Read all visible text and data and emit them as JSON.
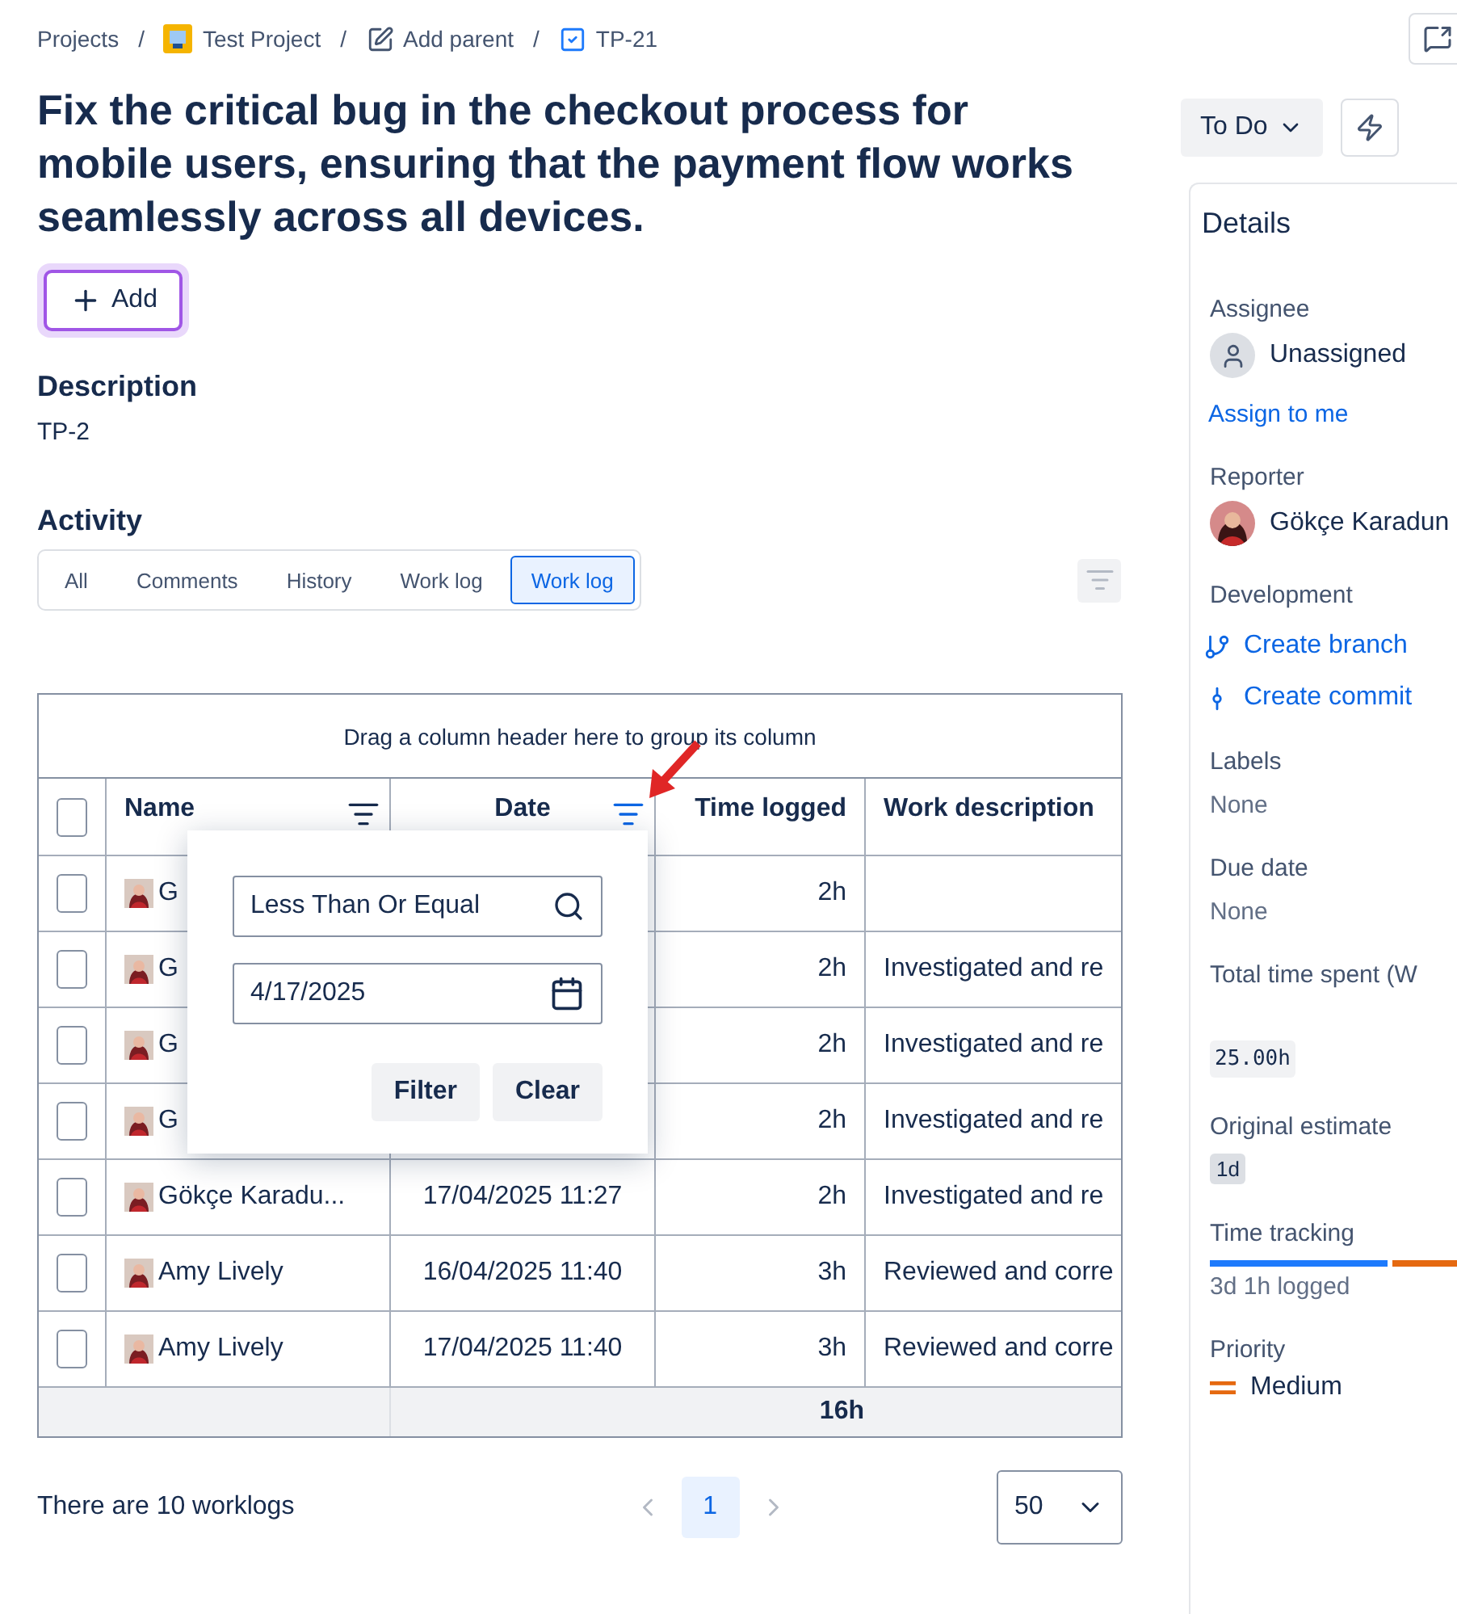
{
  "breadcrumbs": [
    {
      "kind": "text",
      "label": "Projects",
      "separator": "/"
    },
    {
      "kind": "project",
      "label": "Test Project",
      "separator": "/"
    },
    {
      "kind": "edit",
      "label": "Add parent",
      "separator": "/"
    },
    {
      "kind": "issue",
      "label": "TP-21"
    }
  ],
  "title": "Fix the critical bug in the checkout process for mobile users, ensuring that the payment flow works seamlessly across all devices.",
  "add_button": "Add",
  "description": {
    "heading": "Description",
    "text": "TP-2"
  },
  "activity": {
    "heading": "Activity",
    "tabs": [
      {
        "label": "All",
        "selected": false
      },
      {
        "label": "Comments",
        "selected": false
      },
      {
        "label": "History",
        "selected": false
      },
      {
        "label": "Work log",
        "selected": false
      },
      {
        "label": "Work log",
        "selected": true
      }
    ]
  },
  "table": {
    "group_hint": "Drag a column header here to group its column",
    "all_checked": false,
    "columns": [
      {
        "label": "Name",
        "filter_active": false
      },
      {
        "label": "Date",
        "filter_active": true
      },
      {
        "label": "Time logged"
      },
      {
        "label": "Work description"
      }
    ],
    "rows": [
      {
        "checked": false,
        "name": "G",
        "time": "2h"
      },
      {
        "checked": false,
        "name": "G",
        "time": "2h",
        "description": "Investigated and re"
      },
      {
        "checked": false,
        "name": "G",
        "time": "2h",
        "description": "Investigated and re"
      },
      {
        "checked": false,
        "name": "G",
        "time": "2h",
        "description": "Investigated and re"
      },
      {
        "checked": false,
        "name": "Gökçe Karadu...",
        "date": "17/04/2025 11:27",
        "time": "2h",
        "description": "Investigated and re"
      },
      {
        "checked": false,
        "name": "Amy Lively",
        "date": "16/04/2025 11:40",
        "time": "3h",
        "description": "Reviewed and corre"
      },
      {
        "checked": false,
        "name": "Amy Lively",
        "date": "17/04/2025 11:40",
        "time": "3h",
        "description": "Reviewed and corre"
      }
    ],
    "total": "16h"
  },
  "filter_popup": {
    "operator": "Less Than Or Equal",
    "date": "4/17/2025",
    "buttons": [
      "Filter",
      "Clear"
    ]
  },
  "footer": {
    "count": "There are 10 worklogs",
    "pages": [
      {
        "label": "1",
        "selected": true
      }
    ],
    "page_size": "50"
  },
  "status": "To Do",
  "details": {
    "heading": "Details",
    "sections": [
      {
        "label": "Assignee",
        "kind": "unassigned",
        "value": "Unassigned",
        "action": "Assign to me"
      },
      {
        "label": "Reporter",
        "value": "Gökçe Karadun"
      },
      {
        "label": "Development",
        "kind": "links",
        "links": [
          {
            "label": "Create branch"
          },
          {
            "label": "Create commit"
          }
        ]
      },
      {
        "label": "Labels",
        "kind": "plain",
        "value": "None"
      },
      {
        "label": "Due date",
        "kind": "plain",
        "value": "None"
      },
      {
        "label": "Total time spent (W",
        "kind": "code",
        "value": "25.00h"
      },
      {
        "label": "Original estimate",
        "kind": "tag",
        "value": "1d"
      },
      {
        "label": "Time tracking",
        "kind": "progress",
        "level": 0.74,
        "value": "3d 1h logged"
      },
      {
        "label": "Priority",
        "kind": "priority",
        "value": "Medium"
      }
    ]
  }
}
